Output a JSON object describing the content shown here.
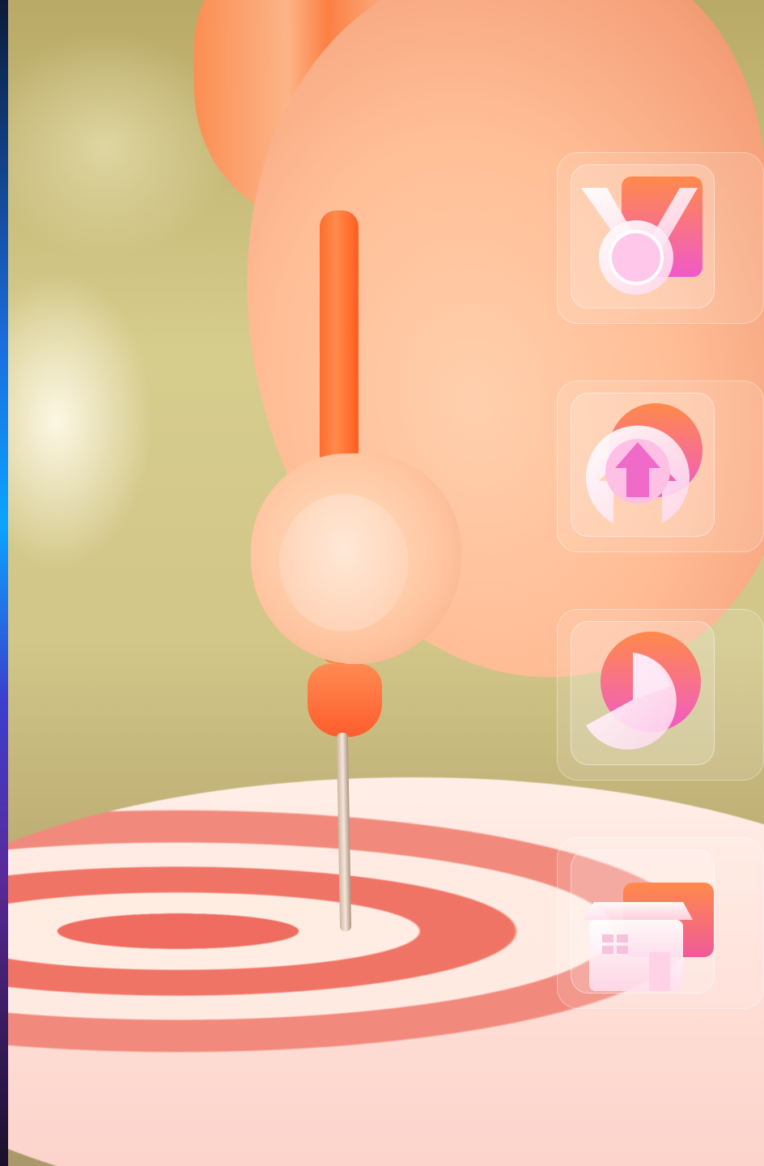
{
  "image": {
    "subject": "hand-pressing-orange-dart-into-dartboard-bullseye"
  },
  "icon_cards": [
    {
      "icon": "medal-icon"
    },
    {
      "icon": "upload-arrow-icon"
    },
    {
      "icon": "pie-chart-icon"
    },
    {
      "icon": "store-icon"
    }
  ],
  "colors": {
    "accent_orange": "#ff7a3e",
    "accent_pink": "#f06ac8",
    "glass_white": "#ffffff",
    "bullseye_red": "#ee6a60"
  }
}
